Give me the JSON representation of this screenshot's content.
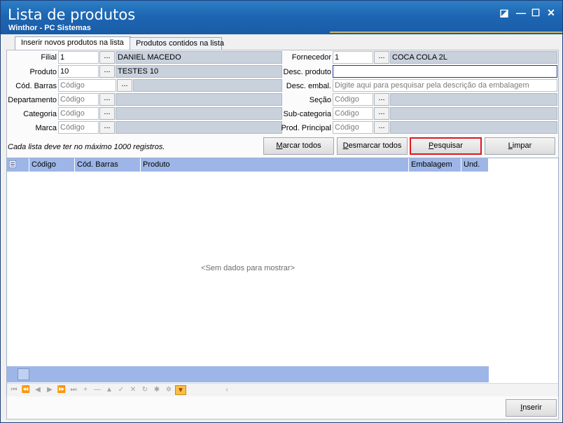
{
  "window": {
    "title": "Lista de produtos",
    "subtitle": "Winthor - PC Sistemas",
    "controls": {
      "edit": "◪",
      "minimize": "—",
      "maximize": "☐",
      "close": "✕"
    }
  },
  "tabs": [
    {
      "label": "Inserir novos produtos na lista",
      "active": true
    },
    {
      "label": "Produtos contidos na lista",
      "active": false
    }
  ],
  "form": {
    "filial": {
      "label": "Filial",
      "value": "1",
      "ellipsis": "...",
      "desc": "DANIEL MACEDO"
    },
    "produto": {
      "label": "Produto",
      "value": "10",
      "ellipsis": "...",
      "desc": "TESTES 10"
    },
    "cod_barras": {
      "label": "Cód. Barras",
      "placeholder": "Código",
      "ellipsis": "..."
    },
    "departamento": {
      "label": "Departamento",
      "placeholder": "Código",
      "ellipsis": "..."
    },
    "categoria": {
      "label": "Categoria",
      "placeholder": "Código",
      "ellipsis": "..."
    },
    "marca": {
      "label": "Marca",
      "placeholder": "Código",
      "ellipsis": "..."
    },
    "fornecedor": {
      "label": "Fornecedor",
      "value": "1",
      "ellipsis": "...",
      "desc": "COCA COLA 2L"
    },
    "desc_produto": {
      "label": "Desc. produto",
      "value": ""
    },
    "desc_embal": {
      "label": "Desc. embal.",
      "placeholder": "Digite aqui para pesquisar pela descrição da embalagem"
    },
    "secao": {
      "label": "Seção",
      "placeholder": "Código",
      "ellipsis": "..."
    },
    "sub_categoria": {
      "label": "Sub-categoria",
      "placeholder": "Código",
      "ellipsis": "..."
    },
    "prod_principal": {
      "label": "Prod. Principal",
      "placeholder": "Código",
      "ellipsis": "..."
    }
  },
  "note": "Cada lista deve ter no máximo 1000 registros.",
  "buttons": {
    "marcar_todos": {
      "hotkey": "M",
      "rest": "arcar todos"
    },
    "desmarcar_todos": {
      "hotkey": "D",
      "rest": "esmarcar todos"
    },
    "pesquisar": {
      "hotkey": "P",
      "rest": "esquisar"
    },
    "limpar": {
      "hotkey": "L",
      "rest": "impar"
    },
    "inserir": {
      "hotkey": "I",
      "rest": "nserir"
    }
  },
  "grid": {
    "columns": [
      "Código",
      "Cód. Barras",
      "Produto",
      "Embalagem",
      "Und."
    ],
    "empty_text": "<Sem dados para mostrar>",
    "nav_icons": [
      "first",
      "prev-page",
      "prev",
      "next",
      "next-page",
      "last",
      "append",
      "delete",
      "edit",
      "post",
      "cancel",
      "refresh",
      "bookmark",
      "goto-bookmark",
      "filter"
    ]
  },
  "colors": {
    "titlebar": "#1d66b3",
    "grid_header": "#9db6e7",
    "highlight": "#e0161e",
    "readonly_field": "#c9d1dd"
  }
}
